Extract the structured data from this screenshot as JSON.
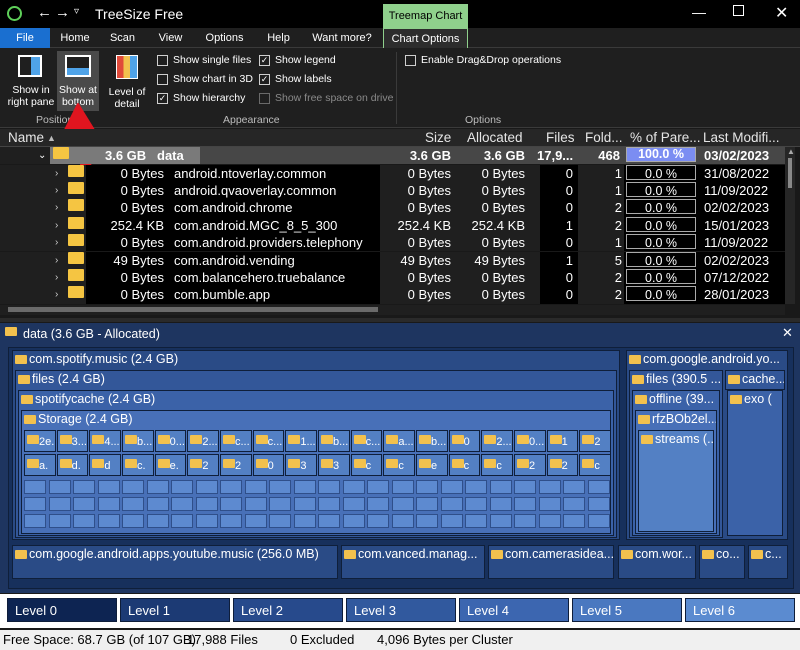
{
  "app": {
    "title": "TreeSize Free",
    "context_tab": "Treemap Chart"
  },
  "tabs": [
    "File",
    "Home",
    "Scan",
    "View",
    "Options",
    "Help",
    "Want more?",
    "Chart Options"
  ],
  "ribbon": {
    "position": {
      "group": "Position",
      "show_right": "Show in right pane",
      "show_bottom": "Show at bottom"
    },
    "level_detail": "Level of detail",
    "appearance": {
      "group": "Appearance",
      "items": [
        {
          "label": "Show single files",
          "checked": false
        },
        {
          "label": "Show chart in 3D",
          "checked": false
        },
        {
          "label": "Show hierarchy",
          "checked": true
        },
        {
          "label": "Show legend",
          "checked": true
        },
        {
          "label": "Show labels",
          "checked": true
        },
        {
          "label": "Show free space on drive",
          "checked": false
        }
      ]
    },
    "options": {
      "group": "Options",
      "drag_drop": "Enable Drag&Drop operations"
    }
  },
  "columns": [
    "Name",
    "Size",
    "Allocated",
    "Files",
    "Fold...",
    "% of Pare...",
    "Last Modifi..."
  ],
  "root_row": {
    "size_label": "3.6 GB",
    "name": "data",
    "size": "3.6 GB",
    "allocated": "3.6 GB",
    "files": "17,9...",
    "folders": "468",
    "pct": "100.0 %",
    "modified": "03/02/2023"
  },
  "rows": [
    {
      "size_label": "0 Bytes",
      "name": "android.ntoverlay.common",
      "size": "0 Bytes",
      "allocated": "0 Bytes",
      "files": "0",
      "folders": "1",
      "pct": "0.0 %",
      "modified": "31/08/2022"
    },
    {
      "size_label": "0 Bytes",
      "name": "android.qvaoverlay.common",
      "size": "0 Bytes",
      "allocated": "0 Bytes",
      "files": "0",
      "folders": "1",
      "pct": "0.0 %",
      "modified": "11/09/2022"
    },
    {
      "size_label": "0 Bytes",
      "name": "com.android.chrome",
      "size": "0 Bytes",
      "allocated": "0 Bytes",
      "files": "0",
      "folders": "2",
      "pct": "0.0 %",
      "modified": "02/02/2023"
    },
    {
      "size_label": "252.4 KB",
      "name": "com.android.MGC_8_5_300",
      "size": "252.4 KB",
      "allocated": "252.4 KB",
      "files": "1",
      "folders": "2",
      "pct": "0.0 %",
      "modified": "15/01/2023"
    },
    {
      "size_label": "0 Bytes",
      "name": "com.android.providers.telephony",
      "size": "0 Bytes",
      "allocated": "0 Bytes",
      "files": "0",
      "folders": "1",
      "pct": "0.0 %",
      "modified": "11/09/2022"
    },
    {
      "size_label": "49 Bytes",
      "name": "com.android.vending",
      "size": "49 Bytes",
      "allocated": "49 Bytes",
      "files": "1",
      "folders": "5",
      "pct": "0.0 %",
      "modified": "02/02/2023"
    },
    {
      "size_label": "0 Bytes",
      "name": "com.balancehero.truebalance",
      "size": "0 Bytes",
      "allocated": "0 Bytes",
      "files": "0",
      "folders": "2",
      "pct": "0.0 %",
      "modified": "07/12/2022"
    },
    {
      "size_label": "0 Bytes",
      "name": "com.bumble.app",
      "size": "0 Bytes",
      "allocated": "0 Bytes",
      "files": "0",
      "folders": "2",
      "pct": "0.0 %",
      "modified": "28/01/2023"
    }
  ],
  "treemap": {
    "title": "data (3.6 GB - Allocated)",
    "spotify": "com.spotify.music (2.4 GB)",
    "files": "files (2.4 GB)",
    "spotifycache": "spotifycache (2.4 GB)",
    "storage": "Storage (2.4 GB)",
    "gyo": "com.google.android.yo...",
    "files390": "files (390.5 ...",
    "cache": "cache...",
    "offline": "offline (39...",
    "exo": "exo (",
    "rfz": "rfzBOb2el...",
    "streams": "streams (...",
    "youtube": "com.google.android.apps.youtube.music (256.0 MB)",
    "vanced": "com.vanced.manag...",
    "camera": "com.camerasidea...",
    "wor": "com.wor...",
    "co1": "co...",
    "co2": "c...",
    "cells_row1": [
      "2e...",
      "3...",
      "4...",
      "b...",
      "0...",
      "2...",
      "c...",
      "c...",
      "1...",
      "b...",
      "c...",
      "a...",
      "b...",
      "0",
      "2...",
      "0...",
      "1",
      "2"
    ],
    "cells_row2": [
      "a.",
      "d.",
      "d",
      "c.",
      "e.",
      "2",
      "2",
      "0",
      "3",
      "3",
      "c",
      "c",
      "e",
      "c",
      "c",
      "2",
      "2",
      "c"
    ]
  },
  "levels": [
    "Level 0",
    "Level 1",
    "Level 2",
    "Level 3",
    "Level 4",
    "Level 5",
    "Level 6"
  ],
  "level_colors": [
    "#0d2452",
    "#1c3a74",
    "#274a8c",
    "#31599e",
    "#3c66b0",
    "#4a78c0",
    "#5b8bd0"
  ],
  "status": {
    "free": "Free Space: 68.7 GB  (of 107 GB)",
    "files": "17,988 Files",
    "excluded": "0 Excluded",
    "cluster": "4,096 Bytes per Cluster"
  }
}
